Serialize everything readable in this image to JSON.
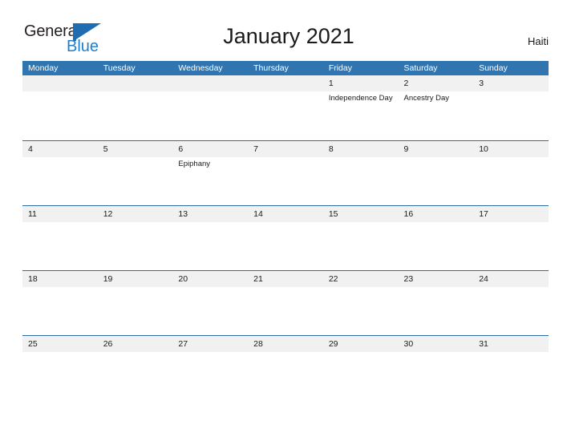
{
  "brand": {
    "name_part1": "General",
    "name_part2": "Blue",
    "flag_icon": "flag-triangle-icon",
    "colors": {
      "text_dark": "#231f20",
      "blue": "#1f7fd0",
      "flag_blue": "#1f6cb0"
    }
  },
  "header": {
    "title": "January 2021",
    "country": "Haiti"
  },
  "calendar": {
    "colors": {
      "header_blue": "#3175b0",
      "row_band": "#f1f1f1",
      "row_rule": "#2e6da4"
    },
    "weekdays": [
      "Monday",
      "Tuesday",
      "Wednesday",
      "Thursday",
      "Friday",
      "Saturday",
      "Sunday"
    ],
    "weeks": [
      {
        "days": [
          {
            "num": "",
            "events": []
          },
          {
            "num": "",
            "events": []
          },
          {
            "num": "",
            "events": []
          },
          {
            "num": "",
            "events": []
          },
          {
            "num": "1",
            "events": [
              "Independence Day"
            ]
          },
          {
            "num": "2",
            "events": [
              "Ancestry Day"
            ]
          },
          {
            "num": "3",
            "events": []
          }
        ]
      },
      {
        "days": [
          {
            "num": "4",
            "events": []
          },
          {
            "num": "5",
            "events": []
          },
          {
            "num": "6",
            "events": [
              "Epiphany"
            ]
          },
          {
            "num": "7",
            "events": []
          },
          {
            "num": "8",
            "events": []
          },
          {
            "num": "9",
            "events": []
          },
          {
            "num": "10",
            "events": []
          }
        ]
      },
      {
        "days": [
          {
            "num": "11",
            "events": []
          },
          {
            "num": "12",
            "events": []
          },
          {
            "num": "13",
            "events": []
          },
          {
            "num": "14",
            "events": []
          },
          {
            "num": "15",
            "events": []
          },
          {
            "num": "16",
            "events": []
          },
          {
            "num": "17",
            "events": []
          }
        ]
      },
      {
        "days": [
          {
            "num": "18",
            "events": []
          },
          {
            "num": "19",
            "events": []
          },
          {
            "num": "20",
            "events": []
          },
          {
            "num": "21",
            "events": []
          },
          {
            "num": "22",
            "events": []
          },
          {
            "num": "23",
            "events": []
          },
          {
            "num": "24",
            "events": []
          }
        ]
      },
      {
        "days": [
          {
            "num": "25",
            "events": []
          },
          {
            "num": "26",
            "events": []
          },
          {
            "num": "27",
            "events": []
          },
          {
            "num": "28",
            "events": []
          },
          {
            "num": "29",
            "events": []
          },
          {
            "num": "30",
            "events": []
          },
          {
            "num": "31",
            "events": []
          }
        ]
      }
    ]
  }
}
